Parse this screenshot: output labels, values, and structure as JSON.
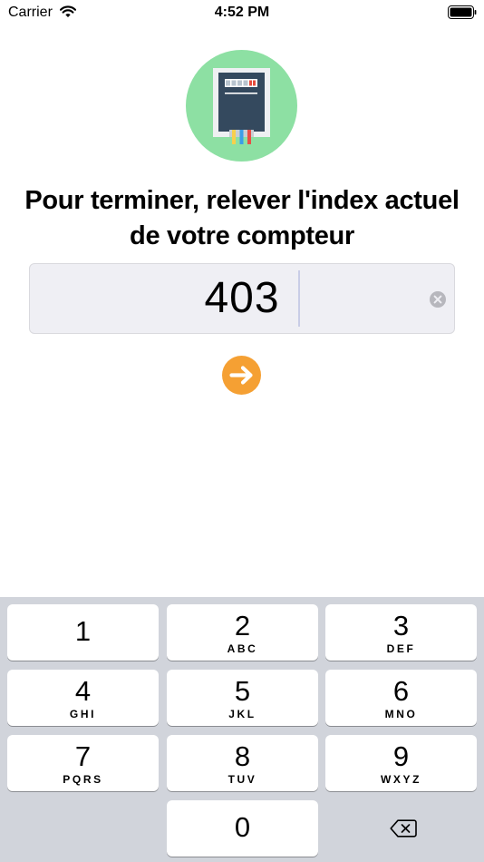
{
  "status_bar": {
    "carrier": "Carrier",
    "time": "4:52 PM"
  },
  "illustration": {
    "icon": "electricity-meter-icon",
    "circle_color": "#8de0a3"
  },
  "title": "Pour terminer, relever l'index actuel de votre compteur",
  "index_field": {
    "value": "403",
    "clear_icon": "clear-icon"
  },
  "next_button": {
    "icon": "arrow-right-icon",
    "color": "#f5a033"
  },
  "keypad": {
    "keys": [
      {
        "digit": "1",
        "letters": ""
      },
      {
        "digit": "2",
        "letters": "ABC"
      },
      {
        "digit": "3",
        "letters": "DEF"
      },
      {
        "digit": "4",
        "letters": "GHI"
      },
      {
        "digit": "5",
        "letters": "JKL"
      },
      {
        "digit": "6",
        "letters": "MNO"
      },
      {
        "digit": "7",
        "letters": "PQRS"
      },
      {
        "digit": "8",
        "letters": "TUV"
      },
      {
        "digit": "9",
        "letters": "WXYZ"
      },
      {
        "digit": "0",
        "letters": ""
      }
    ],
    "delete_icon": "backspace-icon"
  }
}
